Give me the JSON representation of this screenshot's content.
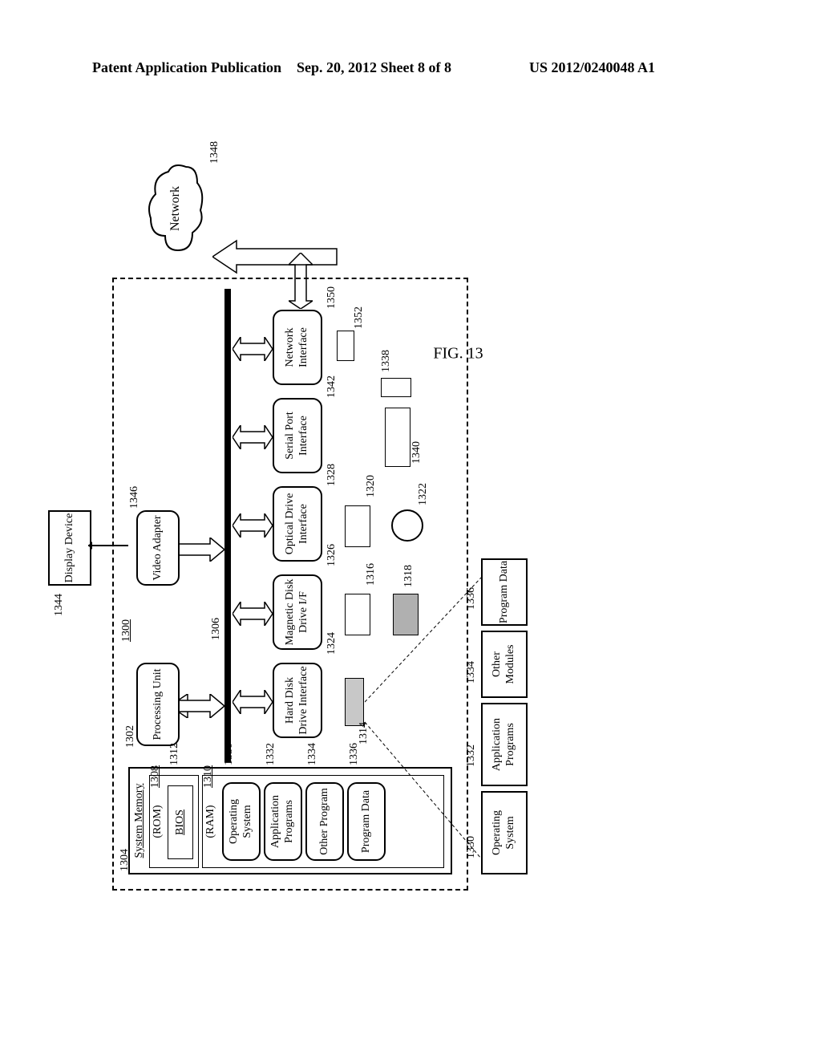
{
  "header": {
    "left": "Patent Application Publication",
    "mid": "Sep. 20, 2012   Sheet 8 of 8",
    "right": "US 2012/0240048 A1"
  },
  "fig": "FIG. 13",
  "refs": {
    "r1300": "1300",
    "r1302": "1302",
    "r1304": "1304",
    "r1306": "1306",
    "r1308": "1308",
    "r1310": "1310",
    "r1312": "1312",
    "r1314": "1314",
    "r1316": "1316",
    "r1318": "1318",
    "r1320": "1320",
    "r1322": "1322",
    "r1324": "1324",
    "r1326": "1326",
    "r1328": "1328",
    "r1330": "1330",
    "r1332a": "1332",
    "r1332b": "1332",
    "r1334a": "1334",
    "r1334b": "1334",
    "r1336a": "1336",
    "r1336b": "1336",
    "r1338": "1338",
    "r1340": "1340",
    "r1342": "1342",
    "r1344": "1344",
    "r1346": "1346",
    "r1348": "1348",
    "r1350": "1350",
    "r1352": "1352"
  },
  "blocks": {
    "system_memory": "System Memory",
    "rom": "(ROM)",
    "bios": "BIOS",
    "ram": "(RAM)",
    "os": "Operating System",
    "app": "Application Programs",
    "other": "Other Program",
    "progdata": "Program Data",
    "processing_unit": "Processing Unit",
    "video_adapter": "Video Adapter",
    "hdd_if": "Hard Disk Drive Interface",
    "mag_if": "Magnetic Disk Drive I/F",
    "opt_if": "Optical Drive Interface",
    "serial_if": "Serial Port Interface",
    "net_if": "Network Interface",
    "display": "Display Device",
    "network": "Network",
    "os2": "Operating System",
    "app2": "Application Programs",
    "other2": "Other Modules",
    "progdata2": "Program Data"
  }
}
